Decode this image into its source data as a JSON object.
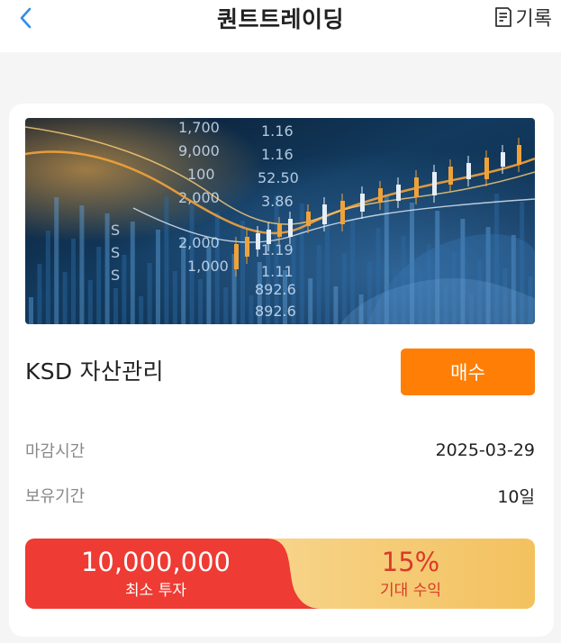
{
  "header": {
    "title": "퀀트트레이딩",
    "history_label": "기록"
  },
  "product": {
    "name": "KSD 자산관리",
    "buy_label": "매수",
    "banner_numbers": [
      "1,700",
      "9,000",
      "100",
      "2,000",
      "2,000",
      "1,000",
      "892.6",
      "892.6",
      "1.16",
      "1.16",
      "52.50",
      "3.86",
      "1.11",
      "1.19",
      "S",
      "S",
      "S"
    ]
  },
  "details": {
    "deadline_label": "마감시간",
    "deadline_value": "2025-03-29",
    "period_label": "보유기간",
    "period_value": "10일"
  },
  "summary": {
    "min_invest_amount": "10,000,000",
    "min_invest_label": "최소 투자",
    "expected_return_value": "15%",
    "expected_return_label": "기대 수익"
  },
  "colors": {
    "accent_orange": "#ff7e06",
    "summary_red": "#ee3b33",
    "summary_gold": "#f6c46a",
    "return_red": "#d93a2a",
    "back_blue": "#2f8ee8"
  },
  "icons": {
    "back": "chevron-left-icon",
    "history": "document-list-icon"
  }
}
